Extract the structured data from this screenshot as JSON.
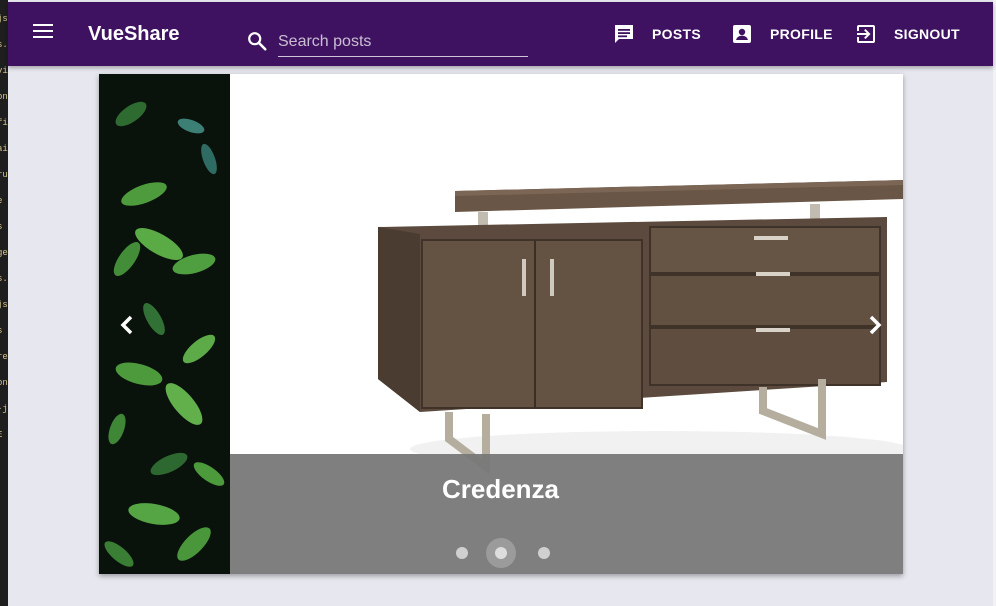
{
  "app": {
    "brand": "VueShare",
    "search_placeholder": "Search posts",
    "nav": [
      {
        "label": "POSTS",
        "icon": "chat-icon"
      },
      {
        "label": "PROFILE",
        "icon": "account-box-icon"
      },
      {
        "label": "SIGNOUT",
        "icon": "exit-to-app-icon"
      }
    ]
  },
  "editor_strip": [
    "js",
    "s.js",
    "vi",
    "on",
    "",
    "fil",
    "ai",
    "ru",
    "",
    "e",
    "s",
    "ge",
    "",
    "s.j",
    "js",
    "s",
    "re",
    "on",
    "",
    "-j",
    "E"
  ],
  "carousel": {
    "caption": "Credenza",
    "slide_count": 3,
    "active_slide": 2
  },
  "colors": {
    "toolbar": "#3e1260",
    "page_background": "#e7e7ef",
    "caption_overlay": "#787878"
  }
}
